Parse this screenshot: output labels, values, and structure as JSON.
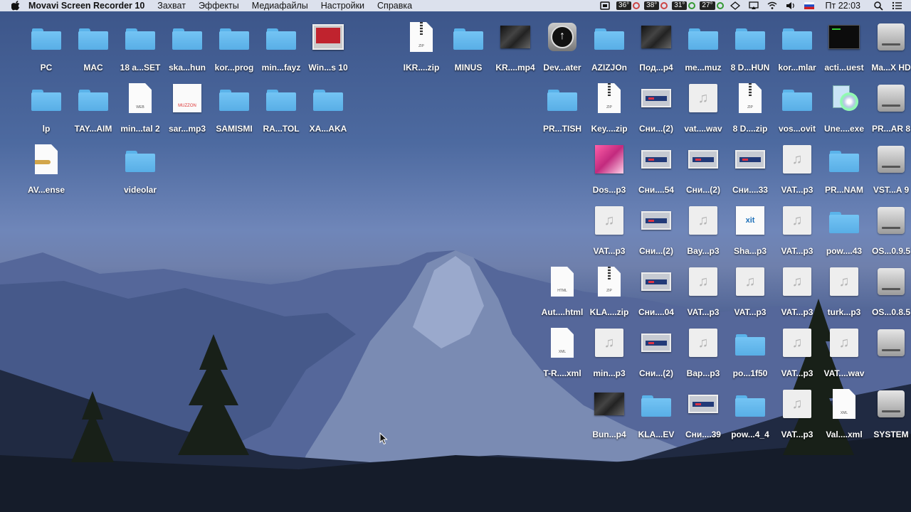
{
  "menubar": {
    "app_name": "Movavi Screen Recorder 10",
    "menus": [
      "Захват",
      "Эффекты",
      "Медиафайлы",
      "Настройки",
      "Справка"
    ],
    "temps": [
      "36°",
      "38°",
      "31°",
      "27°"
    ],
    "clock": "Пт 22:03"
  },
  "desktop": {
    "items": [
      {
        "label": "PC",
        "icon": "folder"
      },
      {
        "label": "MAC",
        "icon": "folder"
      },
      {
        "label": "18 a...SET",
        "icon": "folder"
      },
      {
        "label": "ska...hun",
        "icon": "folder"
      },
      {
        "label": "kor...prog",
        "icon": "folder"
      },
      {
        "label": "min...fayz",
        "icon": "folder"
      },
      {
        "label": "Win...s 10",
        "icon": "parallels"
      },
      {
        "label": "IKR....zip",
        "icon": "zip"
      },
      {
        "label": "MINUS",
        "icon": "folder"
      },
      {
        "label": "KR....mp4",
        "icon": "video"
      },
      {
        "label": "Dev...ater",
        "icon": "updater"
      },
      {
        "label": "AZIZJOn",
        "icon": "folder"
      },
      {
        "label": "Под...p4",
        "icon": "video"
      },
      {
        "label": "me...muz",
        "icon": "folder"
      },
      {
        "label": "8 D...HUN",
        "icon": "folder"
      },
      {
        "label": "kor...mlar",
        "icon": "folder"
      },
      {
        "label": "acti...uest",
        "icon": "terminal"
      },
      {
        "label": "Ma...X HD",
        "icon": "drive"
      },
      {
        "label": "lp",
        "icon": "folder"
      },
      {
        "label": "TAY...AIM",
        "icon": "folder"
      },
      {
        "label": "min...tal 2",
        "icon": "web"
      },
      {
        "label": "sar...mp3",
        "icon": "muzzon"
      },
      {
        "label": "SAMISMI",
        "icon": "folder"
      },
      {
        "label": "RA...TOL",
        "icon": "folder"
      },
      {
        "label": "XA...AKA",
        "icon": "folder"
      },
      {
        "label": "PR...TISH",
        "icon": "folder"
      },
      {
        "label": "Key....zip",
        "icon": "zip"
      },
      {
        "label": "Сни...(2)",
        "icon": "screenshot"
      },
      {
        "label": "vat....wav",
        "icon": "audio"
      },
      {
        "label": "8 D....zip",
        "icon": "zip"
      },
      {
        "label": "vos...ovit",
        "icon": "folder"
      },
      {
        "label": "Une....exe",
        "icon": "exe"
      },
      {
        "label": "PR...AR 8",
        "icon": "drive"
      },
      {
        "label": "AV...ense",
        "icon": "license"
      },
      {
        "label": "videolar",
        "icon": "folder"
      },
      {
        "label": "Dos...p3",
        "icon": "album"
      },
      {
        "label": "Сни....54",
        "icon": "screenshot"
      },
      {
        "label": "Сни...(2)",
        "icon": "screenshot"
      },
      {
        "label": "Сни....33",
        "icon": "screenshot"
      },
      {
        "label": "VAT...p3",
        "icon": "audio"
      },
      {
        "label": "PR...NAM",
        "icon": "folder"
      },
      {
        "label": "VST...A 9",
        "icon": "drive"
      },
      {
        "label": "VAT...p3",
        "icon": "audio"
      },
      {
        "label": "Сни...(2)",
        "icon": "screenshot"
      },
      {
        "label": "Bay...p3",
        "icon": "audio"
      },
      {
        "label": "Sha...p3",
        "icon": "xit"
      },
      {
        "label": "VAT...p3",
        "icon": "audio"
      },
      {
        "label": "pow....43",
        "icon": "folder"
      },
      {
        "label": "OS...0.9.5",
        "icon": "drive"
      },
      {
        "label": "Aut....html",
        "icon": "html"
      },
      {
        "label": "KLA....zip",
        "icon": "zip"
      },
      {
        "label": "Сни....04",
        "icon": "screenshot"
      },
      {
        "label": "VAT...p3",
        "icon": "audio"
      },
      {
        "label": "VAT...p3",
        "icon": "audio"
      },
      {
        "label": "VAT...p3",
        "icon": "audio"
      },
      {
        "label": "turk...p3",
        "icon": "audio"
      },
      {
        "label": "OS...0.8.5",
        "icon": "drive"
      },
      {
        "label": "T-R....xml",
        "icon": "xml"
      },
      {
        "label": "min...p3",
        "icon": "audio"
      },
      {
        "label": "Сни...(2)",
        "icon": "screenshot"
      },
      {
        "label": "Bap...p3",
        "icon": "audio"
      },
      {
        "label": "po...1f50",
        "icon": "folder"
      },
      {
        "label": "VAT...p3",
        "icon": "audio"
      },
      {
        "label": "VAT....wav",
        "icon": "audio"
      },
      {
        "label": "",
        "icon": "drive"
      },
      {
        "label": "Bun...p4",
        "icon": "video"
      },
      {
        "label": "KLA...EV",
        "icon": "folder"
      },
      {
        "label": "Сни....39",
        "icon": "screenshot"
      },
      {
        "label": "pow...4_4",
        "icon": "folder"
      },
      {
        "label": "VAT...p3",
        "icon": "audio"
      },
      {
        "label": "Val....xml",
        "icon": "xml"
      },
      {
        "label": "SYSTEM",
        "icon": "drive"
      }
    ]
  }
}
